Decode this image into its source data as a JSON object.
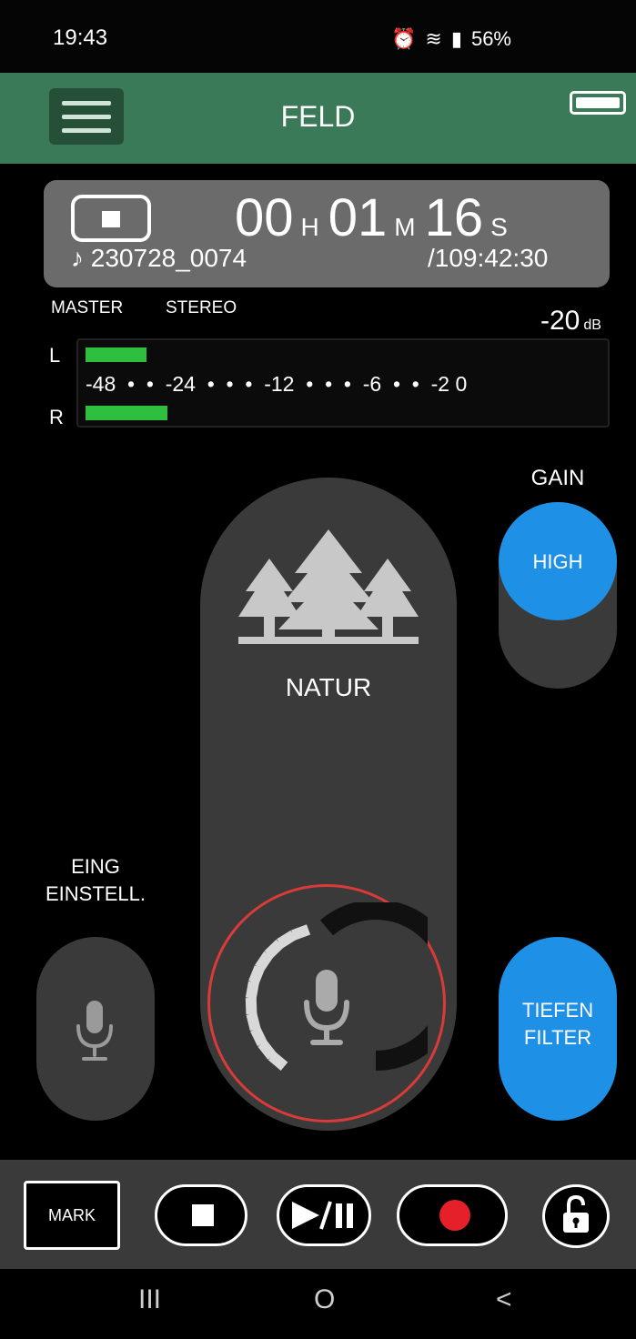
{
  "status_bar": {
    "time": "19:43",
    "battery_percent": "56%",
    "icons": [
      "notification-icon",
      "alarm-icon",
      "wifi-icon",
      "signal-icon",
      "battery-icon"
    ]
  },
  "app_bar": {
    "title": "FELD",
    "menu_icon": "hamburger-menu-icon",
    "device_battery_level": 1.0
  },
  "counter": {
    "state_icon": "stop-icon",
    "hours": "00",
    "hours_unit": "H",
    "minutes": "01",
    "minutes_unit": "M",
    "seconds": "16",
    "seconds_unit": "S",
    "filename": "♪ 230728_0074",
    "remaining": "/109:42:30"
  },
  "meter": {
    "master_label": "MASTER",
    "mode_label": "STEREO",
    "level_value": "-20",
    "level_unit": "dB",
    "left_label": "L",
    "right_label": "R",
    "scale": "-48  •  •  -24  •  •  •  -12  •  •  •  -6  •  •  -2 0",
    "left_level": 0.12,
    "right_level": 0.16
  },
  "scene": {
    "label": "NATUR",
    "icon": "trees-icon",
    "input_level_segments_lit": 11,
    "ring_color": "#d93a3a"
  },
  "gain": {
    "label": "GAIN",
    "value": "HIGH",
    "accent": "#1e90e6"
  },
  "input_settings": {
    "label_line1": "EING",
    "label_line2": "EINSTELL.",
    "icon": "microphone-icon"
  },
  "low_cut": {
    "label_line1": "TIEFEN",
    "label_line2": "FILTER",
    "accent": "#1e90e6"
  },
  "transport": {
    "mark_label": "MARK",
    "stop_icon": "stop-icon",
    "play_pause_icon": "play-pause-icon",
    "record_icon": "record-icon",
    "lock_icon": "unlock-icon",
    "record_color": "#e6202a"
  },
  "nav_bar": {
    "recents": "III",
    "home": "O",
    "back": "<"
  }
}
